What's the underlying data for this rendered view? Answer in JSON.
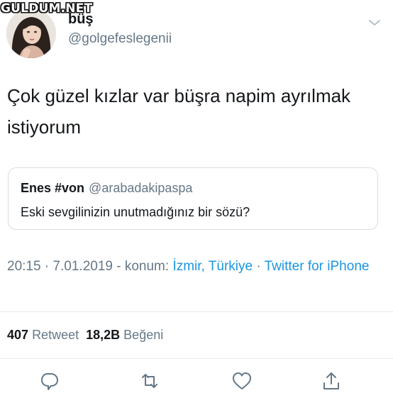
{
  "watermark": "GULDUM.NET",
  "author": {
    "display_name": "büş",
    "handle": "@golgefeslegenii"
  },
  "tweet": {
    "text": "Çok güzel kızlar var büşra napim ayrılmak istiyorum"
  },
  "quoted_tweet": {
    "display_name": "Enes #von",
    "handle": "@arabadakipaspa",
    "text": "Eski sevgilinizin unutmadığınız bir sözü?"
  },
  "meta": {
    "time": "20:15",
    "separator": " · ",
    "date": "7.01.2019",
    "location_prefix": " - konum: ",
    "location": "İzmir, Türkiye",
    "source": "Twitter for iPhone"
  },
  "stats": {
    "retweets_count": "407",
    "retweets_label": "Retweet",
    "likes_count": "18,2B",
    "likes_label": "Beğeni"
  },
  "icons": {
    "menu": "chevron-down-icon",
    "reply": "reply-icon",
    "retweet": "retweet-icon",
    "like": "heart-icon",
    "share": "share-icon"
  },
  "colors": {
    "text_primary": "#14171a",
    "text_secondary": "#657786",
    "link": "#1b95e0",
    "border": "#e6ecf0"
  }
}
